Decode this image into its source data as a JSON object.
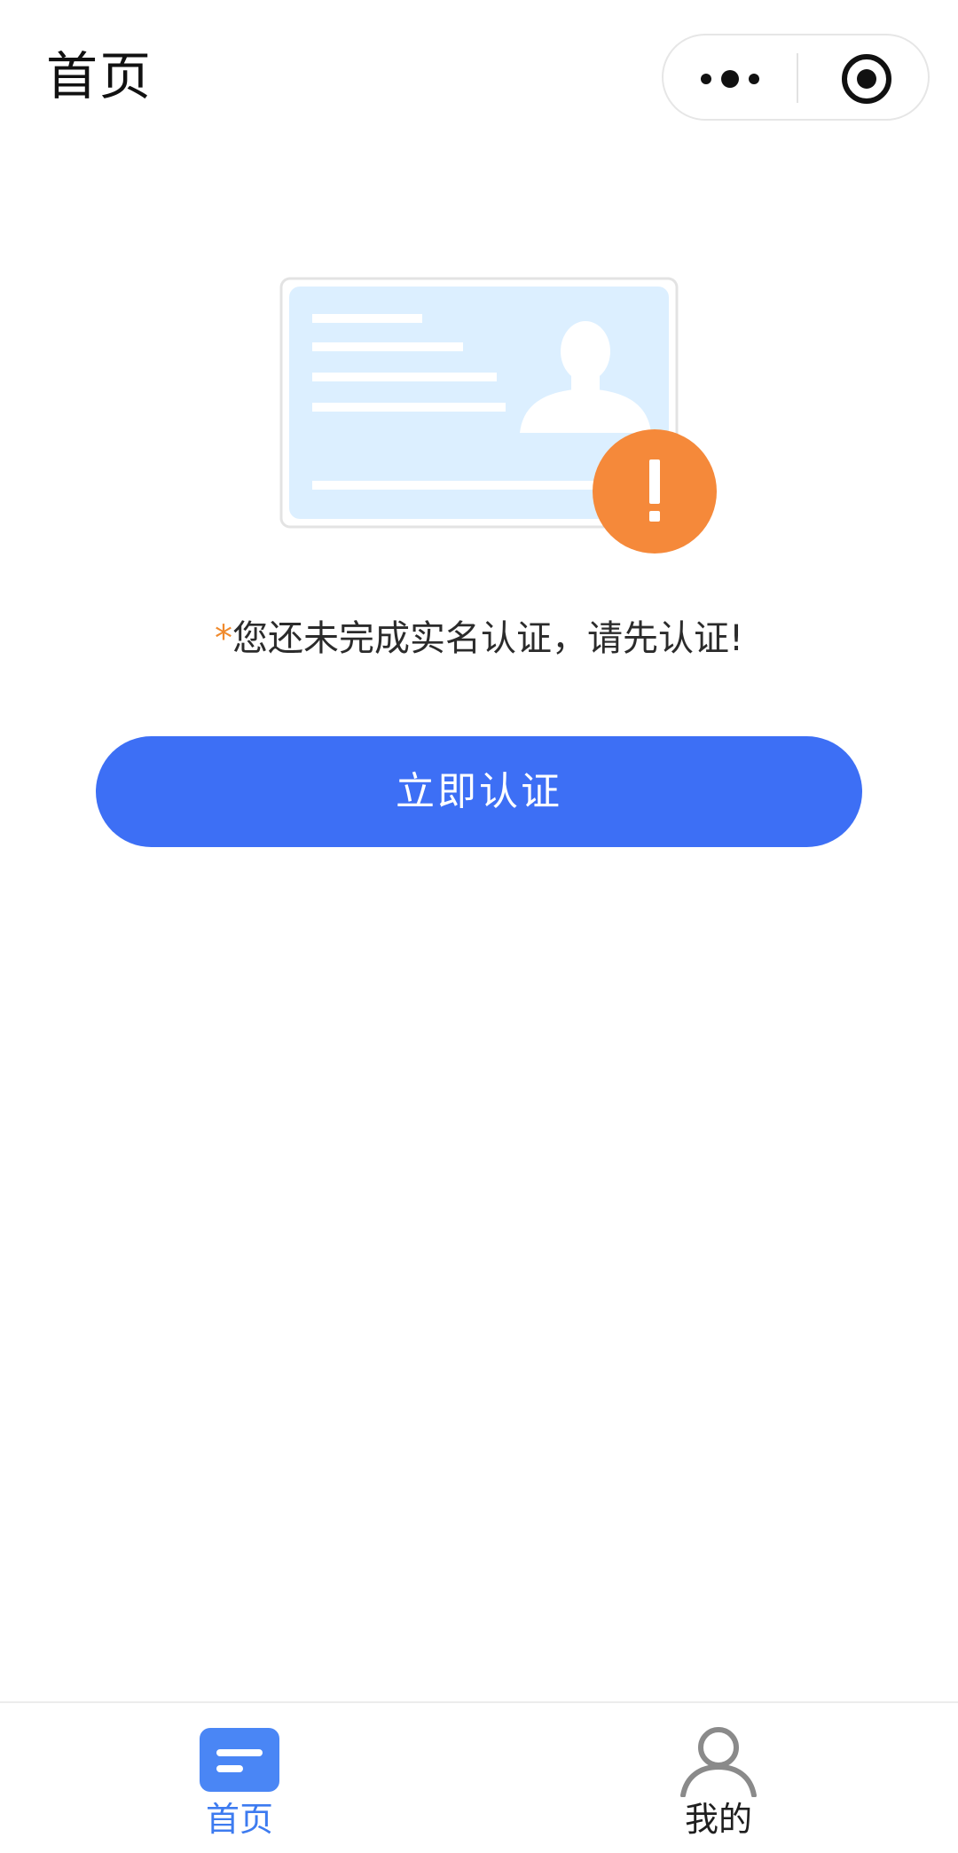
{
  "nav": {
    "title": "首页"
  },
  "capsule": {
    "more_icon": "more-dots-icon",
    "close_icon": "target-close-icon"
  },
  "illustration": {
    "name": "id-card-warning",
    "badge_icon": "exclamation-icon",
    "card_color": "#dcefff",
    "badge_color": "#f5893a"
  },
  "prompt": {
    "asterisk": "*",
    "text": "您还未完成实名认证，请先认证!"
  },
  "actions": {
    "verify_label": "立即认证"
  },
  "tabbar": {
    "items": [
      {
        "label": "首页",
        "icon": "home-doc-icon",
        "active": true
      },
      {
        "label": "我的",
        "icon": "person-icon",
        "active": false
      }
    ]
  },
  "colors": {
    "primary": "#3d6ff5",
    "tab_active": "#3d7bf0",
    "warning": "#f5893a",
    "asterisk": "#f08a2c"
  }
}
